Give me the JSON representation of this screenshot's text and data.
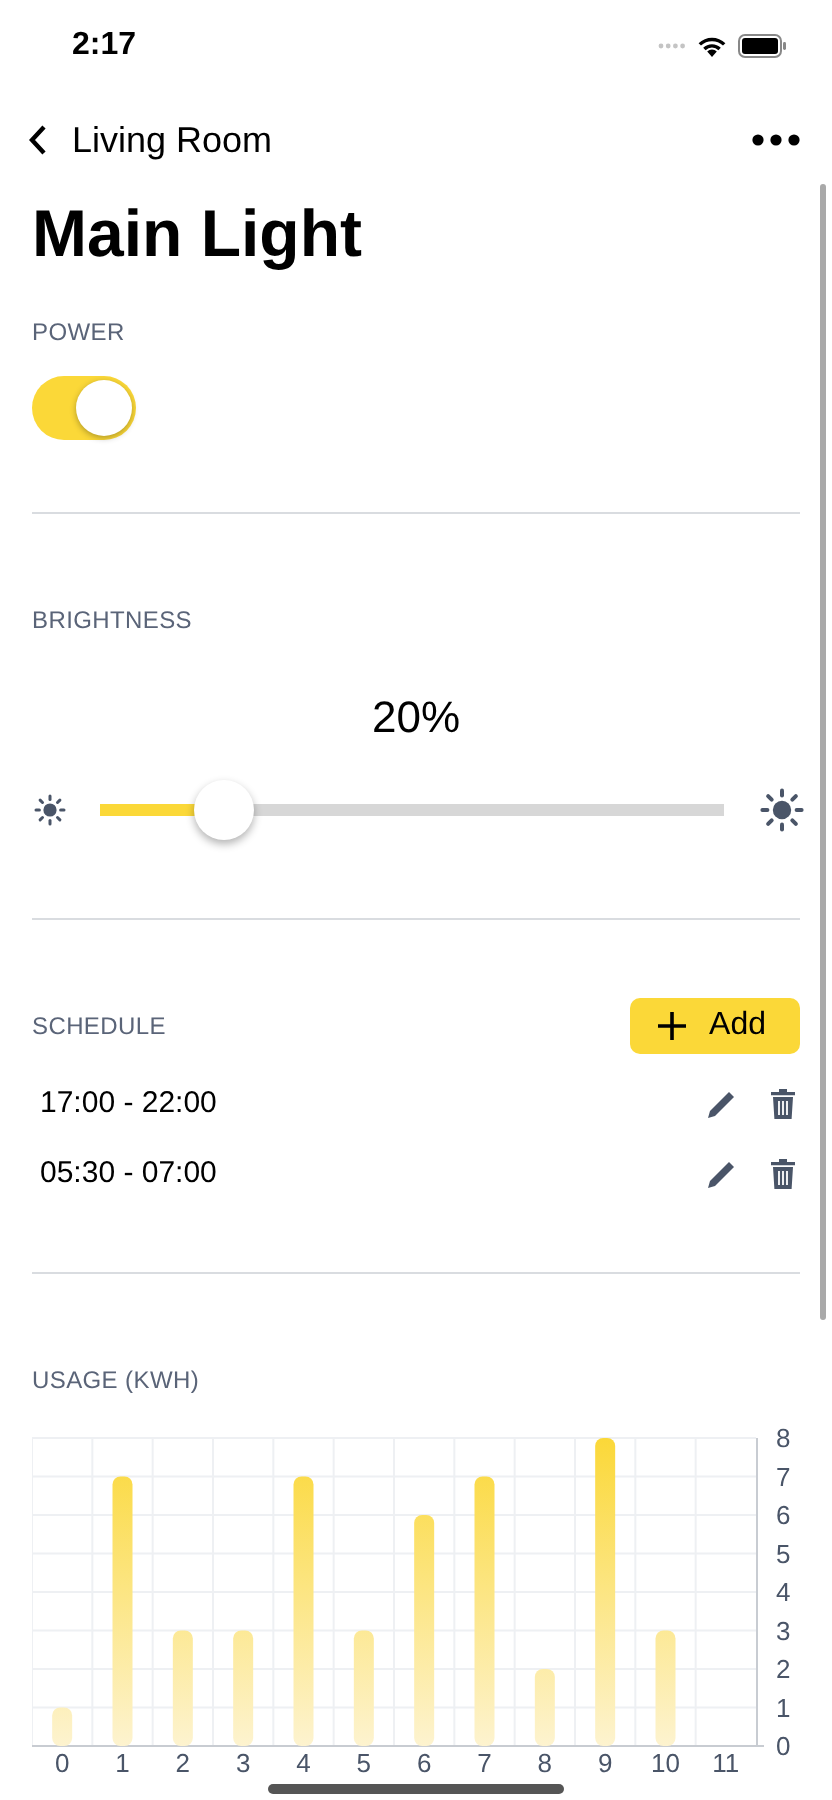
{
  "status_bar": {
    "time": "2:17"
  },
  "nav": {
    "back_label": "Living Room"
  },
  "title": "Main Light",
  "power": {
    "label": "POWER",
    "on": true
  },
  "brightness": {
    "label": "BRIGHTNESS",
    "reading": "20%",
    "level": 0.2
  },
  "schedule": {
    "label": "SCHEDULE",
    "add_button": "Add",
    "entries": [
      {
        "time": "17:00 - 22:00"
      },
      {
        "time": "05:30 - 07:00"
      }
    ]
  },
  "usage": {
    "label": "USAGE (KWH)",
    "chart_data": {
      "type": "bar",
      "categories": [
        "0",
        "1",
        "2",
        "3",
        "4",
        "5",
        "6",
        "7",
        "8",
        "9",
        "10",
        "11"
      ],
      "values": [
        1,
        7,
        3,
        3,
        7,
        3,
        6,
        7,
        2,
        8,
        3,
        0
      ],
      "ylim": [
        0,
        8
      ],
      "grid": true,
      "yticks": [
        0,
        1,
        2,
        3,
        4,
        5,
        6,
        7,
        8
      ]
    }
  }
}
